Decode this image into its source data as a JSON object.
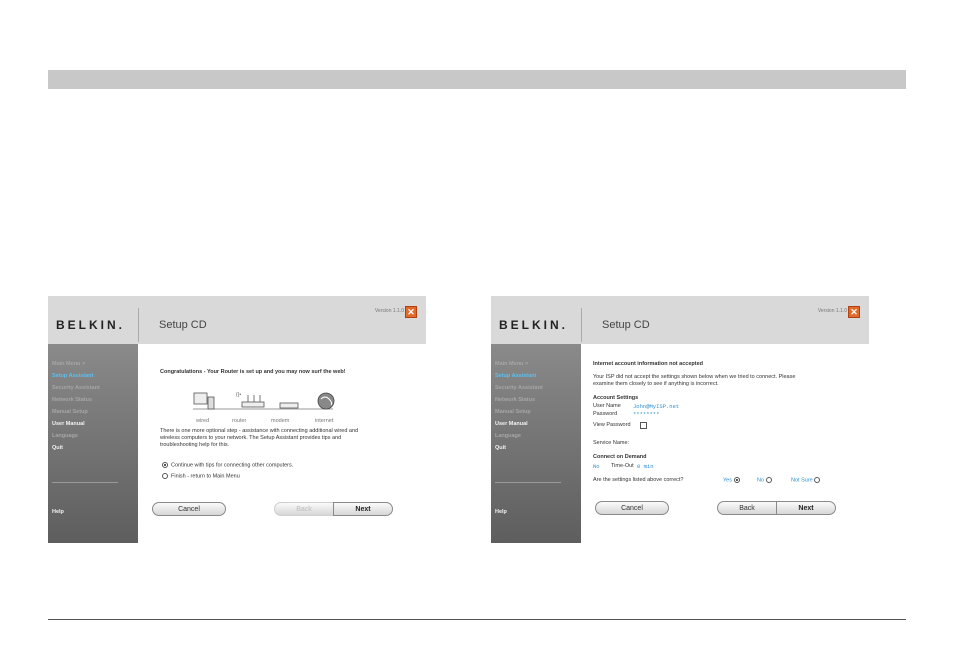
{
  "brand": "BELKIN.",
  "left_window": {
    "title": "Setup CD",
    "version": "Version 1.1.0",
    "sidebar": {
      "items": [
        "Main Menu  >",
        "Setup Assistant",
        "Security Assistant",
        "Network Status",
        "Manual Setup",
        "User Manual",
        "Language",
        "Quit"
      ],
      "help": "Help"
    },
    "headline": "Congratulations - Your Router is set up and you may now surf the web!",
    "diagram_labels": [
      "wired",
      "router",
      "modem",
      "internet"
    ],
    "body_lines": [
      "There is one more optional step - assistance with connecting additional wired and",
      "wireless computers to your network. The Setup Assistant provides tips and",
      "troubleshooting help for this."
    ],
    "options": [
      "Continue with tips for connecting other computers.",
      "Finish - return to Main Menu"
    ],
    "buttons": {
      "cancel": "Cancel",
      "back": "Back",
      "next": "Next"
    }
  },
  "right_window": {
    "title": "Setup CD",
    "version": "Version 1.1.0",
    "sidebar": {
      "items": [
        "Main Menu  >",
        "Setup Assistant",
        "Security Assistant",
        "Network Status",
        "Manual Setup",
        "User Manual",
        "Language",
        "Quit"
      ],
      "help": "Help"
    },
    "headline": "Internet account information not accepted",
    "body_lines": [
      "Your ISP did not accept the settings shown below when we tried to connect. Please",
      "examine them closely to see if anything is incorrect."
    ],
    "account_settings_label": "Account Settings",
    "user_name_label": "User Name",
    "user_name_value": "John@MyISP.net",
    "password_label": "Password",
    "password_value": "********",
    "view_password_label": "View Password",
    "service_name_label": "Service Name:",
    "connect_on_demand_label": "Connect on Demand",
    "connect_value": "No",
    "timeout_label": "Time-Out",
    "timeout_value": "0 min",
    "question": "Are the settings listed above correct?",
    "answers": [
      "Yes",
      "No",
      "Not Sure"
    ],
    "buttons": {
      "cancel": "Cancel",
      "back": "Back",
      "next": "Next"
    }
  }
}
